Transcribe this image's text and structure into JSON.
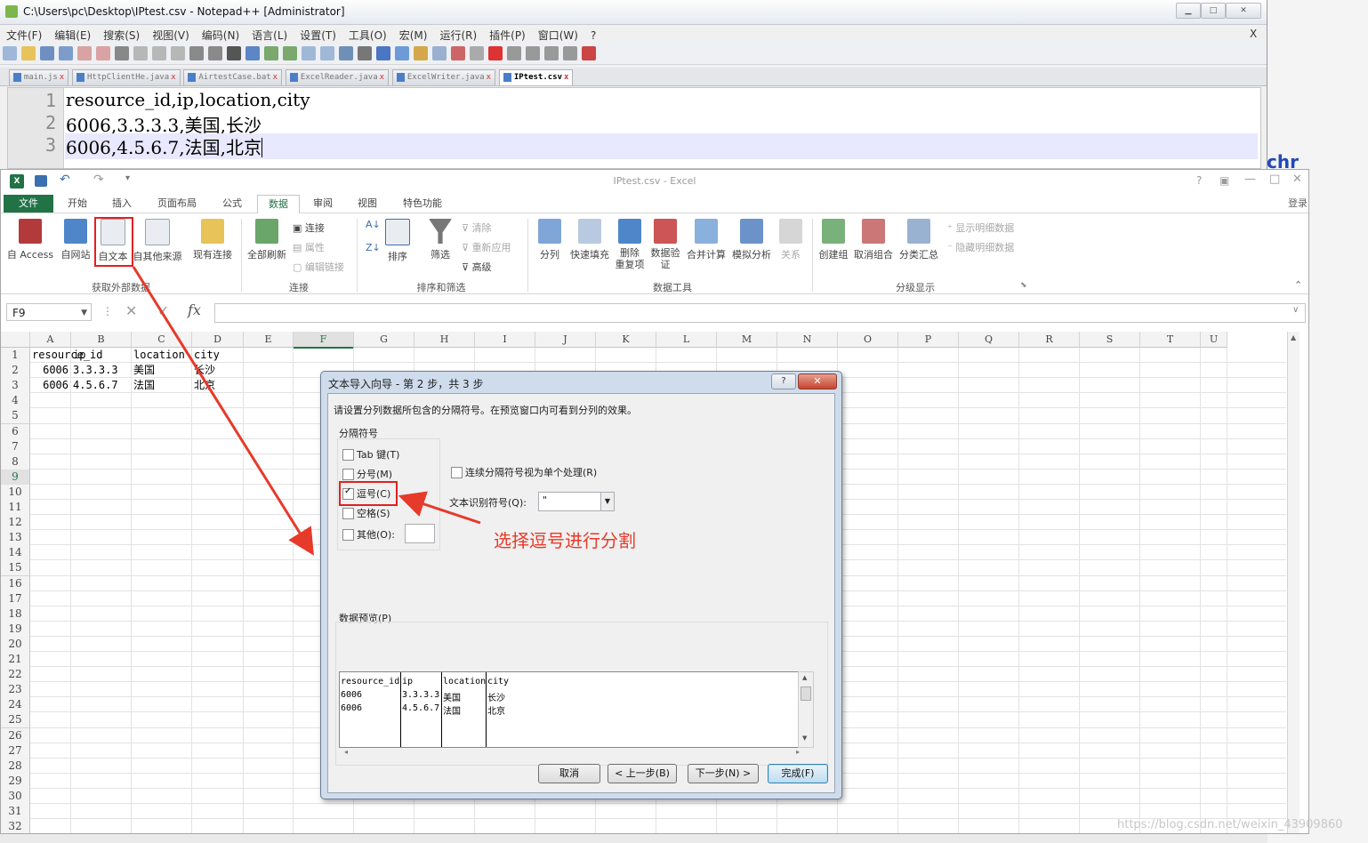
{
  "npp": {
    "title": "C:\\Users\\pc\\Desktop\\IPtest.csv - Notepad++ [Administrator]",
    "menu": [
      "文件(F)",
      "编辑(E)",
      "搜索(S)",
      "视图(V)",
      "编码(N)",
      "语言(L)",
      "设置(T)",
      "工具(O)",
      "宏(M)",
      "运行(R)",
      "插件(P)",
      "窗口(W)",
      "?"
    ],
    "menu_close": "X",
    "tabs": [
      "main.js",
      "HttpClientHe.java",
      "AirtestCase.bat",
      "ExcelReader.java",
      "ExcelWriter.java",
      "IPtest.csv"
    ],
    "tab_close_glyph": "x",
    "lines": [
      {
        "num": "1",
        "text": "resource_id,ip,location,city"
      },
      {
        "num": "2",
        "text": "6006,3.3.3.3,美国,长沙"
      },
      {
        "num": "3",
        "text": "6006,4.5.6.7,法国,北京"
      }
    ]
  },
  "excel": {
    "title": "IPtest.csv - Excel",
    "title_help": "?",
    "signin": "登录",
    "tabs": [
      "文件",
      "开始",
      "插入",
      "页面布局",
      "公式",
      "数据",
      "审阅",
      "视图",
      "特色功能"
    ],
    "ribbon": {
      "ext_buttons": [
        "自 Access",
        "自网站",
        "自文本",
        "自其他来源",
        "现有连接"
      ],
      "refresh": "全部刷新",
      "conn_small": [
        "连接",
        "属性",
        "编辑链接"
      ],
      "sort_small": [
        "Z↓A"
      ],
      "sort": "排序",
      "filter": "筛选",
      "filter_small": [
        "清除",
        "重新应用",
        "高级"
      ],
      "tools": [
        "分列",
        "快速填充",
        "删除\n重复项",
        "数据验\n证",
        "合并计算",
        "模拟分析",
        "关系"
      ],
      "outline": [
        "创建组",
        "取消组合",
        "分类汇总"
      ],
      "outline_small": [
        "显示明细数据",
        "隐藏明细数据"
      ],
      "groups": [
        "获取外部数据",
        "连接",
        "排序和筛选",
        "数据工具",
        "分级显示"
      ]
    },
    "namebox": "F9",
    "fx": "fx",
    "columns": [
      "A",
      "B",
      "C",
      "D",
      "E",
      "F",
      "G",
      "H",
      "I",
      "J",
      "K",
      "L",
      "M",
      "N",
      "O",
      "P",
      "Q",
      "R",
      "S",
      "T",
      "U"
    ],
    "rows": [
      "1",
      "2",
      "3",
      "4",
      "5",
      "6",
      "7",
      "8",
      "9",
      "10",
      "11",
      "12",
      "13",
      "14",
      "15",
      "16",
      "17",
      "18",
      "19",
      "20",
      "21",
      "22",
      "23",
      "24",
      "25",
      "26",
      "27",
      "28",
      "29",
      "30",
      "31",
      "32"
    ],
    "cells": [
      [
        "resource_id",
        "ip",
        "location",
        "city"
      ],
      [
        "6006",
        "3.3.3.3",
        "美国",
        "长沙"
      ],
      [
        "6006",
        "4.5.6.7",
        "法国",
        "北京"
      ]
    ]
  },
  "dialog": {
    "title": "文本导入向导 - 第 2 步，共 3 步",
    "help": "?",
    "close": "✕",
    "instruction": "请设置分列数据所包含的分隔符号。在预览窗口内可看到分列的效果。",
    "delim_group": "分隔符号",
    "delimiters": [
      {
        "label": "Tab 键(T)",
        "checked": false
      },
      {
        "label": "分号(M)",
        "checked": false
      },
      {
        "label": "逗号(C)",
        "checked": true
      },
      {
        "label": "空格(S)",
        "checked": false
      },
      {
        "label": "其他(O):",
        "checked": false
      }
    ],
    "consecutive": "连续分隔符号视为单个处理(R)",
    "qualifier_label": "文本识别符号(Q):",
    "qualifier_value": "\"",
    "preview_label": "数据预览(P)",
    "preview": [
      [
        "resource_id",
        "ip",
        "location",
        "city"
      ],
      [
        "6006",
        "3.3.3.3",
        "美国",
        "长沙"
      ],
      [
        "6006",
        "4.5.6.7",
        "法国",
        "北京"
      ]
    ],
    "buttons": [
      "取消",
      "< 上一步(B)",
      "下一步(N) >",
      "完成(F)"
    ]
  },
  "annotation": "选择逗号进行分割",
  "side_mark": "chr",
  "watermark": "https://blog.csdn.net/weixin_43909860",
  "colors": {
    "excel_green": "#217346",
    "annotation_red": "#e63a2a",
    "highlight_red": "#e02020"
  }
}
